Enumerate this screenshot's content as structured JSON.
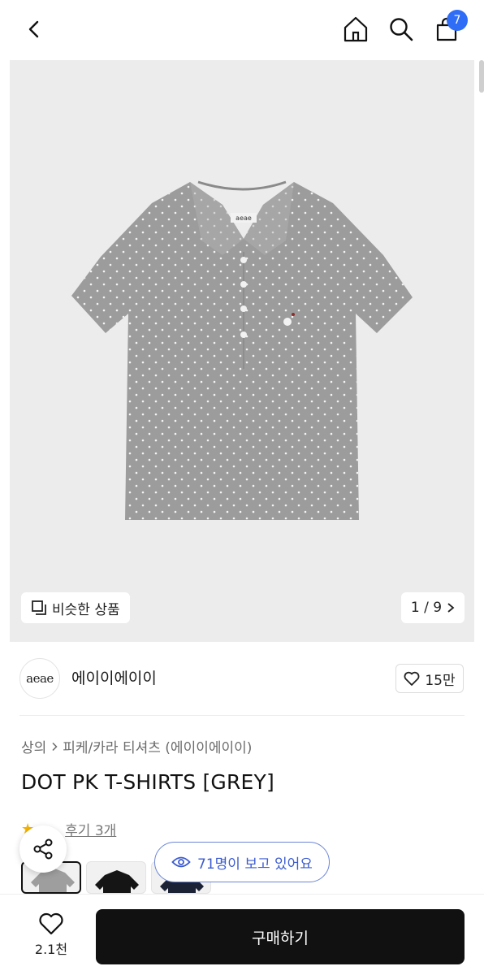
{
  "header": {
    "cart_count": "7",
    "icons": [
      "back-arrow-icon",
      "home-icon",
      "search-icon",
      "shopping-bag-icon"
    ]
  },
  "gallery": {
    "similar_label": "비슷한 상품",
    "page_indicator": "1 / 9",
    "shirt_logo_text": "aeae"
  },
  "brand": {
    "logo_text": "aeae",
    "name": "에이이에이이",
    "likes": "15만"
  },
  "product": {
    "breadcrumb": [
      "상의",
      "피케/카라 티셔츠 (에이이에이이)"
    ],
    "title": "DOT PK T-SHIRTS [GREY]",
    "review_label": "후기 3개"
  },
  "viewer": {
    "text": "71명이 보고 있어요"
  },
  "bottom_bar": {
    "wish_count": "2.1천",
    "buy_label": "구매하기"
  },
  "colors": {
    "accent_blue": "#2f6df6",
    "viewer_blue": "#3b5bd0",
    "shirt_grey": "#9a9a9a",
    "buy_button": "#111111"
  }
}
